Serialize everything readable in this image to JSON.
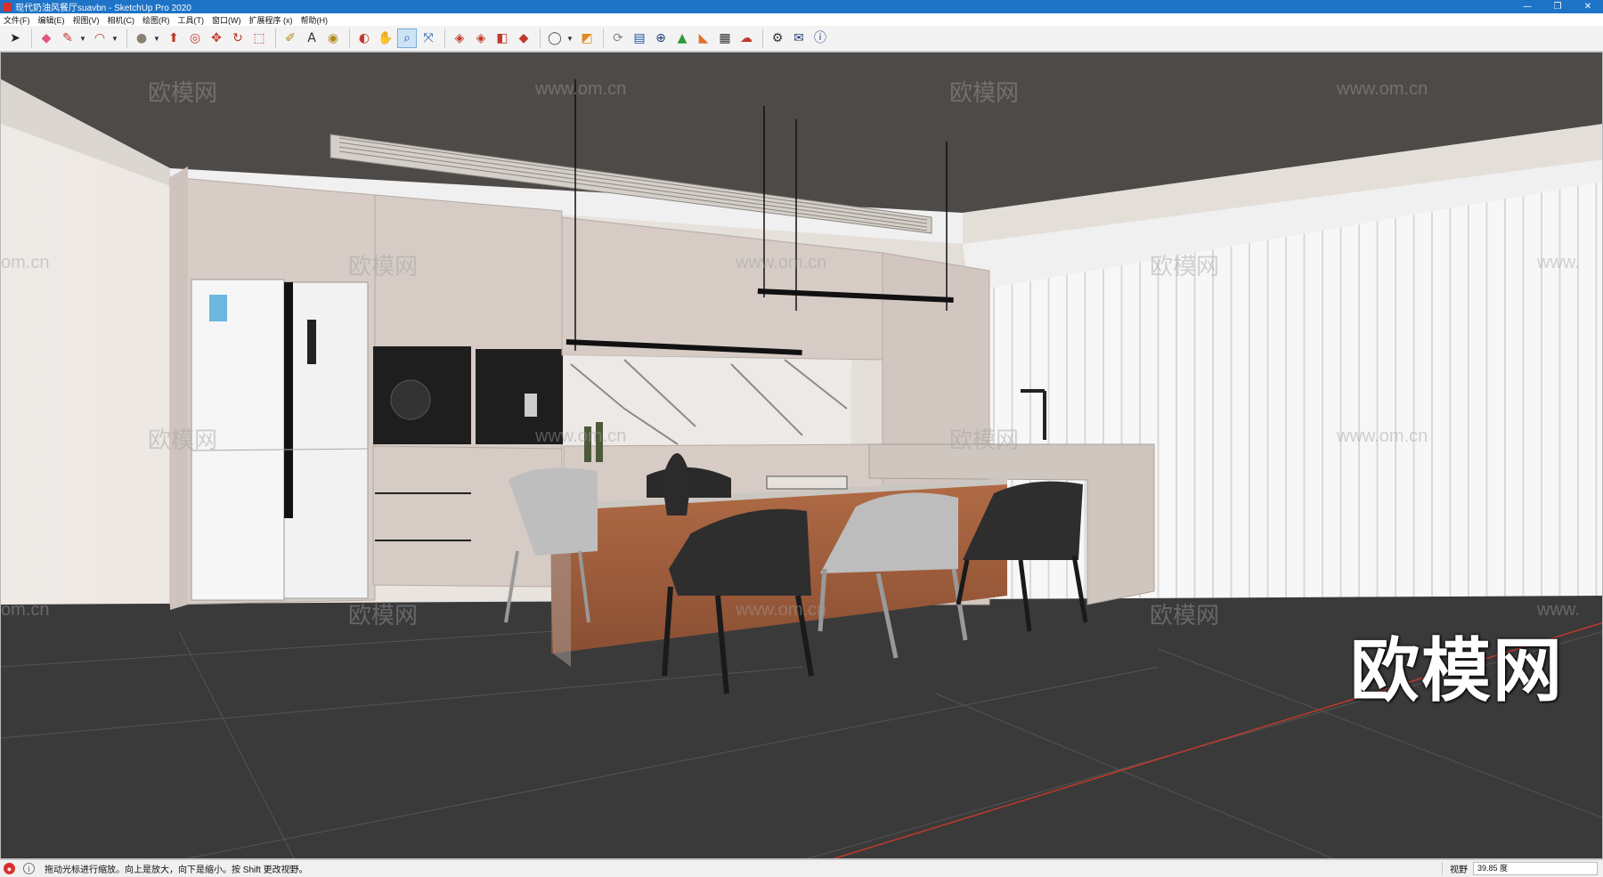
{
  "window": {
    "title": "现代奶油风餐厅suavbn - SketchUp Pro 2020",
    "minimize_glyph": "—",
    "restore_glyph": "❐",
    "close_glyph": "✕"
  },
  "menu": [
    {
      "label": "文件(F)"
    },
    {
      "label": "编辑(E)"
    },
    {
      "label": "视图(V)"
    },
    {
      "label": "相机(C)"
    },
    {
      "label": "绘图(R)"
    },
    {
      "label": "工具(T)"
    },
    {
      "label": "窗口(W)"
    },
    {
      "label": "扩展程序 (x)"
    },
    {
      "label": "帮助(H)"
    }
  ],
  "toolbar": {
    "tools": [
      {
        "name": "select-tool-icon",
        "glyph": "➤",
        "color": "#222222"
      },
      {
        "name": "eraser-tool-icon",
        "glyph": "◆",
        "color": "#e0567a"
      },
      {
        "name": "line-tool-icon",
        "glyph": "✎",
        "color": "#c0392b"
      },
      {
        "name": "arc-tool-icon",
        "glyph": "◠",
        "color": "#c0392b"
      },
      {
        "name": "shape-tool-icon",
        "glyph": "●",
        "color": "#8a7f70"
      },
      {
        "name": "push-pull-tool-icon",
        "glyph": "⬆",
        "color": "#c0392b"
      },
      {
        "name": "offset-tool-icon",
        "glyph": "◎",
        "color": "#c0392b"
      },
      {
        "name": "move-tool-icon",
        "glyph": "✥",
        "color": "#c0392b"
      },
      {
        "name": "rotate-tool-icon",
        "glyph": "↻",
        "color": "#c0392b"
      },
      {
        "name": "scale-tool-icon",
        "glyph": "⬚",
        "color": "#c0392b"
      },
      {
        "name": "tape-measure-icon",
        "glyph": "✐",
        "color": "#b48a1c"
      },
      {
        "name": "text-tool-icon",
        "glyph": "A",
        "color": "#333333"
      },
      {
        "name": "paint-bucket-icon",
        "glyph": "◉",
        "color": "#b48a1c"
      },
      {
        "name": "orbit-tool-icon",
        "glyph": "◐",
        "color": "#c0392b"
      },
      {
        "name": "pan-tool-icon",
        "glyph": "✋",
        "color": "#b48a1c"
      },
      {
        "name": "zoom-tool-icon",
        "glyph": "⌕",
        "color": "#1f5fa8"
      },
      {
        "name": "zoom-extents-icon",
        "glyph": "⤧",
        "color": "#1f5fa8"
      },
      {
        "name": "warehouse-icon",
        "glyph": "◈",
        "color": "#c0392b"
      },
      {
        "name": "extension-warehouse-icon",
        "glyph": "◈",
        "color": "#c0392b"
      },
      {
        "name": "layout-send-icon",
        "glyph": "◧",
        "color": "#c0392b"
      },
      {
        "name": "extension-manager-icon",
        "glyph": "◆",
        "color": "#c0392b"
      },
      {
        "name": "account-icon",
        "glyph": "◯",
        "color": "#555555"
      },
      {
        "name": "style-tool-icon",
        "glyph": "◩",
        "color": "#e08a1e"
      },
      {
        "name": "sync-icon",
        "glyph": "⟳",
        "color": "#888888"
      },
      {
        "name": "section-plane-icon",
        "glyph": "▤",
        "color": "#1f4fa8"
      },
      {
        "name": "add-location-icon",
        "glyph": "⊕",
        "color": "#1f3f7a"
      },
      {
        "name": "terrain-icon",
        "glyph": "▲",
        "color": "#2e9a3a"
      },
      {
        "name": "shadow-settings-icon",
        "glyph": "◣",
        "color": "#e0702a"
      },
      {
        "name": "materials-icon",
        "glyph": "▦",
        "color": "#333333"
      },
      {
        "name": "cloud-upload-icon",
        "glyph": "☁",
        "color": "#c0392b"
      },
      {
        "name": "settings-gear-icon",
        "glyph": "⚙",
        "color": "#333333"
      },
      {
        "name": "mail-icon",
        "glyph": "✉",
        "color": "#1f3f7a"
      },
      {
        "name": "info-icon",
        "glyph": "ⓘ",
        "color": "#1f3f7a"
      }
    ]
  },
  "viewport": {
    "scene_label": "kitchen-dining 3D model",
    "watermark_text": "欧模网",
    "watermark_url": "www.om.cn",
    "watermark_partial": "om.cn",
    "watermark_partial_right": "www.",
    "brand_logo_text": "欧模网"
  },
  "statusbar": {
    "message": "拖动光标进行缩放。向上是放大，向下是缩小。按 Shift 更改视野。",
    "field_label": "视野",
    "field_value": "39.85 度"
  },
  "colors": {
    "ceiling": "#4e4a47",
    "wall": "#ebe6e1",
    "cabinet": "#d6ccc5",
    "floor": "#3a3a3a",
    "island_wood": "#9c5a3a",
    "chair_dark": "#2e2e2e",
    "chair_light": "#bdbdbd",
    "titlebar": "#1e73c7"
  }
}
